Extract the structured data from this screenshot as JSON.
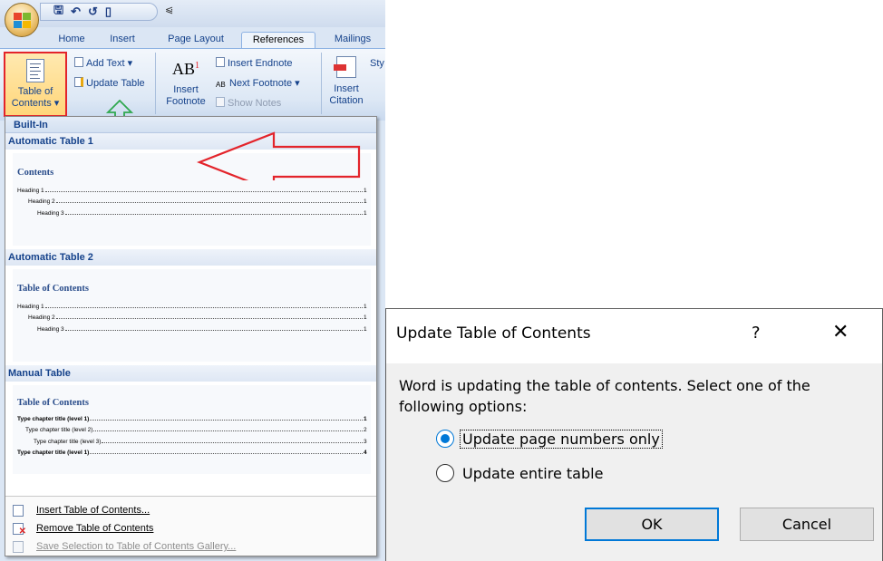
{
  "ribbon": {
    "tabs": [
      "Home",
      "Insert",
      "Page Layout",
      "References",
      "Mailings"
    ],
    "active_tab": "References",
    "toc_button": [
      "Table of",
      "Contents ▾"
    ],
    "add_text": "Add Text ▾",
    "update_table": "Update Table",
    "insert_footnote": [
      "Insert",
      "Footnote"
    ],
    "footnote_icon": "AB",
    "footnote_sup": "1",
    "insert_endnote": "Insert Endnote",
    "next_footnote": "Next Footnote ▾",
    "show_notes": "Show Notes",
    "insert_citation": [
      "Insert",
      "Citation"
    ],
    "style_partial": "Sty"
  },
  "dropdown": {
    "header": "Built-In",
    "sections": [
      {
        "title": "Automatic Table 1",
        "preview_title": "Contents",
        "entries": [
          {
            "text": "Heading 1",
            "num": "1",
            "level": 1,
            "bold": false
          },
          {
            "text": "Heading 2",
            "num": "1",
            "level": 2,
            "bold": false
          },
          {
            "text": "Heading 3",
            "num": "1",
            "level": 3,
            "bold": false
          }
        ]
      },
      {
        "title": "Automatic Table 2",
        "preview_title": "Table of Contents",
        "entries": [
          {
            "text": "Heading 1",
            "num": "1",
            "level": 1,
            "bold": false
          },
          {
            "text": "Heading 2",
            "num": "1",
            "level": 2,
            "bold": false
          },
          {
            "text": "Heading 3",
            "num": "1",
            "level": 3,
            "bold": false
          }
        ]
      },
      {
        "title": "Manual Table",
        "preview_title": "Table of Contents",
        "entries": [
          {
            "text": "Type chapter title (level 1)",
            "num": "1",
            "level": 1,
            "bold": true
          },
          {
            "text": "Type chapter title (level 2)",
            "num": "2",
            "level": 2,
            "bold": false
          },
          {
            "text": "Type chapter title (level 3)",
            "num": "3",
            "level": 3,
            "bold": false
          },
          {
            "text": "Type chapter title (level 1)",
            "num": "4",
            "level": 1,
            "bold": true
          }
        ]
      }
    ],
    "menu": {
      "insert": "Insert Table of Contents...",
      "remove": "Remove Table of Contents",
      "save": "Save Selection to Table of Contents Gallery..."
    }
  },
  "dialog": {
    "title": "Update Table of Contents",
    "help": "?",
    "close": "✕",
    "message": "Word is updating the table of contents.  Select one of the following options:",
    "options": [
      {
        "label": "Update page numbers only",
        "checked": true
      },
      {
        "label": "Update entire table",
        "checked": false
      }
    ],
    "ok": "OK",
    "cancel": "Cancel"
  },
  "colors": {
    "highlight_red": "#e3242b",
    "green_arrow": "#2fa84f",
    "accent_blue": "#0078d7",
    "ribbon_text": "#15428b"
  }
}
